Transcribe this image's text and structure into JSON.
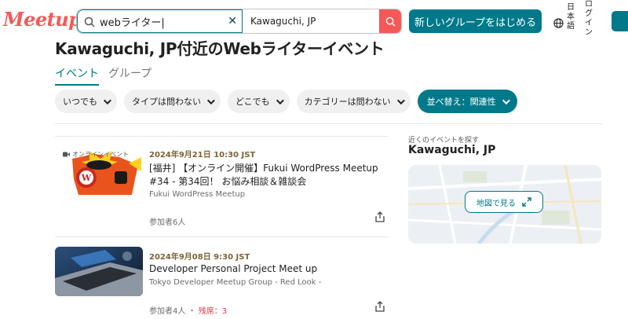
{
  "header": {
    "logo": "Meetup",
    "search_keyword": "webライター|",
    "location": "Kawaguchi, JP",
    "new_group_label": "新しいグループをはじめる",
    "language_label": "日本語",
    "login_label": "ログイン"
  },
  "page": {
    "title": "Kawaguchi, JP付近のWebライターイベント",
    "tabs": [
      {
        "label": "イベント",
        "active": true
      },
      {
        "label": "グループ",
        "active": false
      }
    ]
  },
  "filters": {
    "when": "いつでも",
    "type": "タイプは問わない",
    "where": "どこでも",
    "category": "カテゴリーは問わない",
    "sort": "並べ替え：関連性"
  },
  "events": [
    {
      "online_tag": "オンラインイベント",
      "date": "2024年9月21日 10:30 JST",
      "title": "[福井] 【オンライン開催】Fukui WordPress Meetup #34 - 第34回！ お悩み相談＆雑談会",
      "group": "Fukui WordPress Meetup",
      "attendees": "参加者6人"
    },
    {
      "date": "2024年9月08日 9:30 JST",
      "title": "Developer Personal Project Meet up",
      "group": "Tokyo Developer Meetup Group - Red Look -",
      "attendees": "参加者4人",
      "spots_sep": "・",
      "spots": "残席：3"
    }
  ],
  "sidebar": {
    "label": "近くのイベントを探す",
    "city": "Kawaguchi, JP",
    "map_button": "地図で見る"
  },
  "colors": {
    "brand": "#f65858",
    "accent": "#00798a",
    "date": "#7a6437"
  }
}
